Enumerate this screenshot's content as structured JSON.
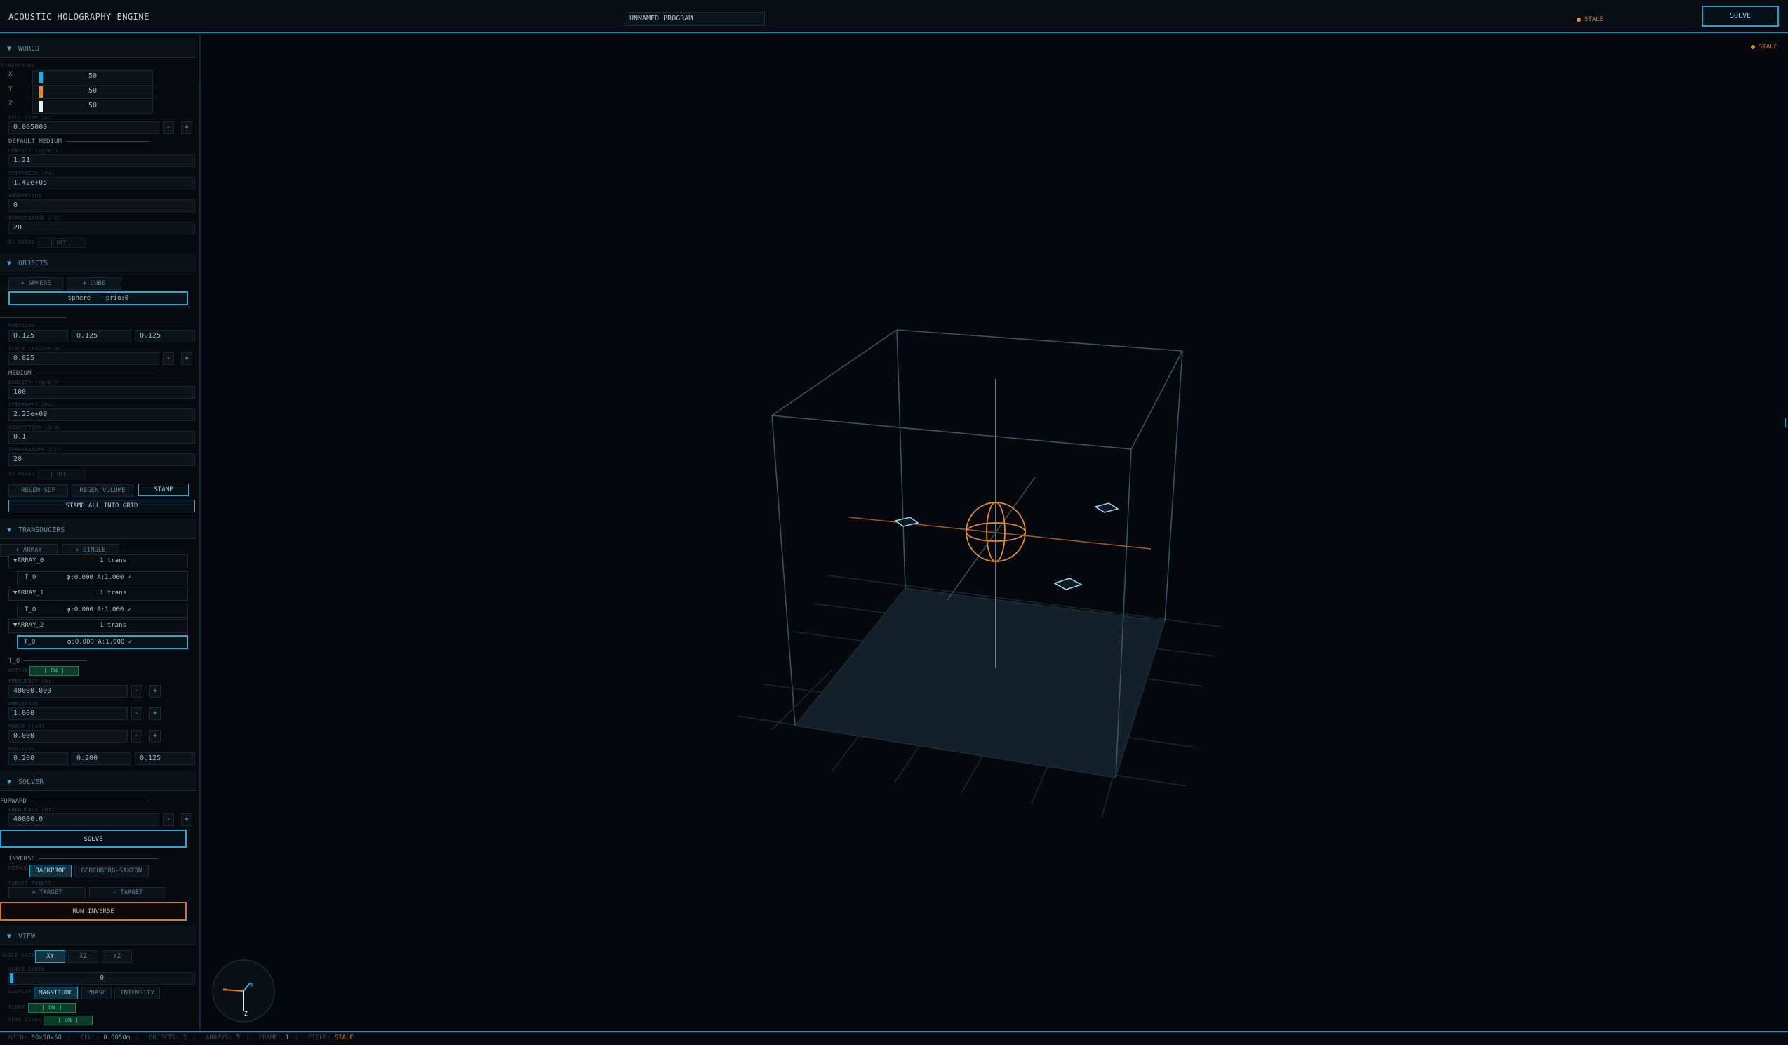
{
  "header": {
    "title": "ACOUSTIC HOLOGRAPHY ENGINE",
    "program_name": "UNNAMED_PROGRAM",
    "status": "STALE",
    "solve_label": "SOLVE"
  },
  "viewport": {
    "status": "STALE",
    "axis_labels": {
      "x": "X",
      "y": "Y",
      "z": "Z"
    }
  },
  "world": {
    "title": "WORLD",
    "dimensions_label": "DIMENSIONS",
    "dims": [
      {
        "axis": "X",
        "value": "50",
        "color": "#2aa8e0"
      },
      {
        "axis": "Y",
        "value": "50",
        "color": "#e08a32"
      },
      {
        "axis": "Z",
        "value": "50",
        "color": "#e8eef2"
      }
    ],
    "cell_size_label": "CELL SIZE (m)",
    "cell_size": "0.005000",
    "default_medium_label": "DEFAULT MEDIUM",
    "density_label": "DENSITY (kg/m³)",
    "density": "1.21",
    "stiffness_label": "STIFFNESS (Pa)",
    "stiffness": "1.42e+05",
    "absorption_label": "ABSORPTION",
    "absorption": "0",
    "temperature_label": "TEMPERATURE (°C)",
    "temperature": "20",
    "is_rigid_label": "IS RIGID",
    "is_rigid": "[ OFF ]"
  },
  "objects": {
    "title": "OBJECTS",
    "add_sphere": "+ SPHERE",
    "add_cube": "+ CUBE",
    "list": [
      {
        "name": "sphere",
        "prio": "prio:0"
      }
    ],
    "position_label": "POSITION",
    "position": [
      "0.125",
      "0.125",
      "0.125"
    ],
    "scale_label": "SCALE (RADIUS m)",
    "scale": "0.025",
    "medium_label": "MEDIUM",
    "density_label": "DENSITY (kg/m³)",
    "density": "100",
    "stiffness_label": "STIFFNESS (Pa)",
    "stiffness": "2.25e+09",
    "absorption_label": "ABSORPTION (1/m)",
    "absorption": "0.1",
    "temperature_label": "TEMPERATURE (°C)",
    "temperature": "20",
    "is_rigid_label": "IS RIGID",
    "is_rigid": "[ OFF ]",
    "regen_sdf": "REGEN SDF",
    "regen_volume": "REGEN VOLUME",
    "stamp": "STAMP",
    "stamp_all": "STAMP ALL INTO GRID"
  },
  "transducers": {
    "title": "TRANSDUCERS",
    "add_array": "+ ARRAY",
    "add_single": "+ SINGLE",
    "arrays": [
      {
        "name": "▼ARRAY_0",
        "count": "1 trans",
        "elements": [
          {
            "name": "T_0",
            "info": "φ:0.000 A:1.000 ✓"
          }
        ]
      },
      {
        "name": "▼ARRAY_1",
        "count": "1 trans",
        "elements": [
          {
            "name": "T_0",
            "info": "φ:0.000 A:1.000 ✓"
          }
        ]
      },
      {
        "name": "▼ARRAY_2",
        "count": "1 trans",
        "elements": [
          {
            "name": "T_0",
            "info": "φ:0.000 A:1.000 ✓"
          }
        ]
      }
    ],
    "selected_label": "T_0",
    "active_label": "ACTIVE",
    "active": "[ ON ]",
    "frequency_label": "FREQUENCY (Hz)",
    "frequency": "40000.000",
    "amplitude_label": "AMPLITUDE",
    "amplitude": "1.000",
    "phase_label": "PHASE (rad)",
    "phase": "0.000",
    "position_label": "POSITION",
    "position": [
      "0.200",
      "0.200",
      "0.125"
    ]
  },
  "solver": {
    "title": "SOLVER",
    "forward_label": "FORWARD",
    "frequency_label": "FREQUENCY (Hz)",
    "frequency": "40000.0",
    "solve": "SOLVE",
    "inverse_label": "INVERSE",
    "method_label": "METHOD",
    "method_backprop": "BACKPROP",
    "method_gs": "GERCHBERG-SAXTON",
    "target_points_label": "TARGET POINTS",
    "add_target": "+ TARGET",
    "remove_target": "- TARGET",
    "run_inverse": "RUN INVERSE"
  },
  "view": {
    "title": "VIEW",
    "slice_axis_label": "SLICE AXIS",
    "axes": [
      "XY",
      "XZ",
      "YZ"
    ],
    "slice_index_label": "SLICE INDEX",
    "slice_index": "0",
    "slice_index_fraction": 0,
    "display_label": "DISPLAY",
    "display_modes": [
      "MAGNITUDE",
      "PHASE",
      "INTENSITY"
    ],
    "floor_label": "FLOOR",
    "floor": "[ ON ]",
    "grid_lines_label": "GRID LINES",
    "grid_lines": "[ ON ]"
  },
  "statusbar": {
    "grid_label": "GRID:",
    "grid": "50×50×50",
    "cell_label": "CELL:",
    "cell": "0.0050m",
    "objects_label": "OBJECTS:",
    "objects": "1",
    "arrays_label": "ARRAYS:",
    "arrays": "3",
    "frame_label": "FRAME:",
    "frame": "1",
    "field_label": "FIELD:",
    "field": "STALE"
  },
  "colors": {
    "accent": "#2aa8e0",
    "warning": "#e08a32",
    "on": "#36d08a"
  }
}
